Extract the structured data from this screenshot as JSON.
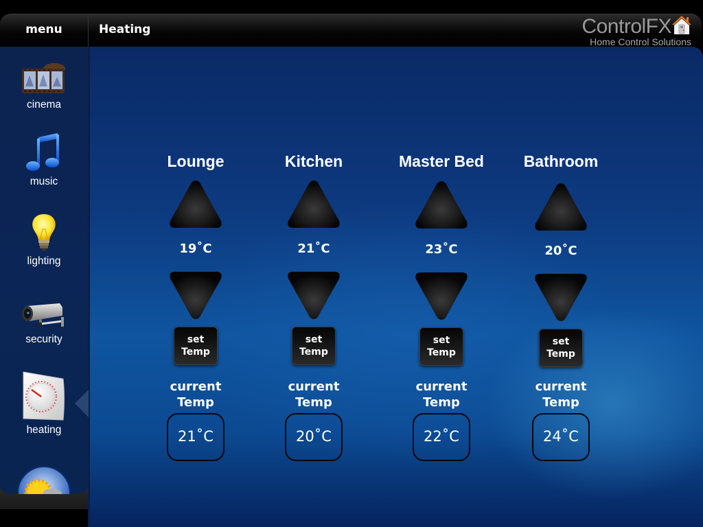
{
  "header": {
    "menu_label": "menu",
    "page_title": "Heating",
    "brand_name": "ControlFX",
    "brand_tagline": "Home Control Solutions",
    "brand_icon": "house-icon"
  },
  "sidebar": {
    "items": [
      {
        "label": "cinema",
        "icon": "film-reel-icon",
        "selected": false
      },
      {
        "label": "music",
        "icon": "music-note-icon",
        "selected": false
      },
      {
        "label": "lighting",
        "icon": "light-bulb-icon",
        "selected": false
      },
      {
        "label": "security",
        "icon": "security-camera-icon",
        "selected": false
      },
      {
        "label": "heating",
        "icon": "thermostat-icon",
        "selected": true
      },
      {
        "label": "",
        "icon": "weather-icon",
        "selected": false
      }
    ]
  },
  "zones": [
    {
      "name": "Lounge",
      "setpoint": "19˚C",
      "set_label_1": "set",
      "set_label_2": "Temp",
      "current_label_1": "current",
      "current_label_2": "Temp",
      "current_temp": "21˚C"
    },
    {
      "name": "Kitchen",
      "setpoint": "21˚C",
      "set_label_1": "set",
      "set_label_2": "Temp",
      "current_label_1": "current",
      "current_label_2": "Temp",
      "current_temp": "20˚C"
    },
    {
      "name": "Master Bed",
      "setpoint": "23˚C",
      "set_label_1": "set",
      "set_label_2": "Temp",
      "current_label_1": "current",
      "current_label_2": "Temp",
      "current_temp": "22˚C"
    },
    {
      "name": "Bathroom",
      "setpoint": "20˚C",
      "set_label_1": "set",
      "set_label_2": "Temp",
      "current_label_1": "current",
      "current_label_2": "Temp",
      "current_temp": "24˚C"
    }
  ],
  "colors": {
    "accent_blue": "#0f55a0",
    "sidebar_blue": "#0b2556",
    "bar_black": "#000000"
  }
}
